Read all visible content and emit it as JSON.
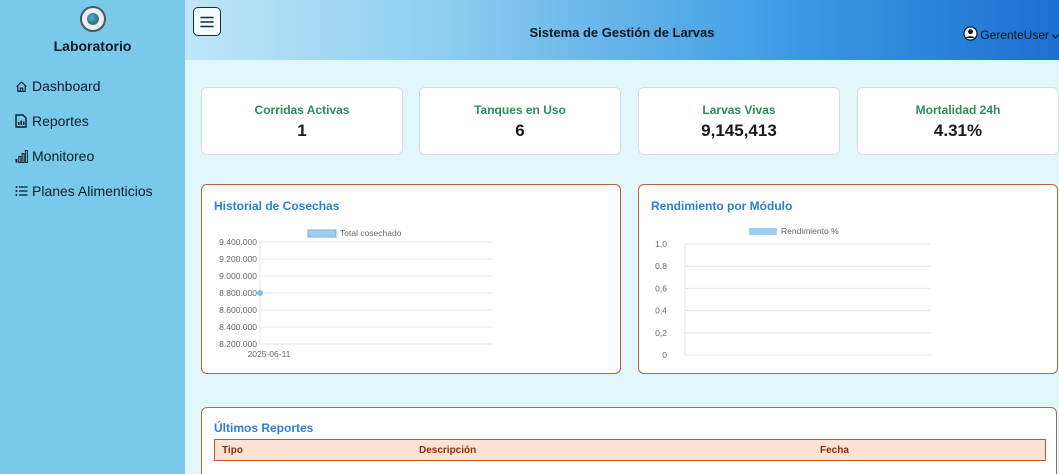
{
  "sidebar": {
    "title": "Laboratorio",
    "items": [
      {
        "label": "Dashboard",
        "icon": "home-icon"
      },
      {
        "label": "Reportes",
        "icon": "report-icon"
      },
      {
        "label": "Monitoreo",
        "icon": "bar-chart-icon"
      },
      {
        "label": "Planes Alimenticios",
        "icon": "list-icon"
      }
    ]
  },
  "header": {
    "title": "Sistema de Gestión de Larvas",
    "user": "GerenteUser"
  },
  "stats": [
    {
      "label": "Corridas Activas",
      "value": "1"
    },
    {
      "label": "Tanques en Uso",
      "value": "6"
    },
    {
      "label": "Larvas Vivas",
      "value": "9,145,413"
    },
    {
      "label": "Mortalidad 24h",
      "value": "4.31%"
    }
  ],
  "charts": {
    "cosechas": {
      "title": "Historial de Cosechas",
      "legend": "Total cosechado",
      "yticks": [
        "9.400.000",
        "9.200.000",
        "9.000.000",
        "8.800.000",
        "8.600.000",
        "8.400.000",
        "8.200.000"
      ],
      "xticks": [
        "2025-06-11"
      ]
    },
    "rendimiento": {
      "title": "Rendimiento por Módulo",
      "legend": "Rendimiento %",
      "yticks": [
        "1,0",
        "0,8",
        "0,6",
        "0,4",
        "0,2",
        "0"
      ]
    }
  },
  "chart_data": [
    {
      "type": "line",
      "title": "Historial de Cosechas",
      "series": [
        {
          "name": "Total cosechado",
          "values": [
            8800000
          ]
        }
      ],
      "x": [
        "2025-06-11"
      ],
      "ylim": [
        8200000,
        9400000
      ],
      "grid": true,
      "legend": "top"
    },
    {
      "type": "bar",
      "title": "Rendimiento por Módulo",
      "series": [
        {
          "name": "Rendimiento %",
          "values": []
        }
      ],
      "categories": [],
      "ylim": [
        0,
        1
      ],
      "grid": true,
      "legend": "top"
    }
  ],
  "reportes": {
    "title": "Últimos Reportes",
    "columns": [
      "Tipo",
      "Descripción",
      "Fecha"
    ]
  },
  "colors": {
    "sidebar": "#79c9ea",
    "accent": "#2d7ed6",
    "stat_label": "#2e8b57",
    "panel_border": "#b8633a",
    "series1": "#9dd0f0"
  }
}
